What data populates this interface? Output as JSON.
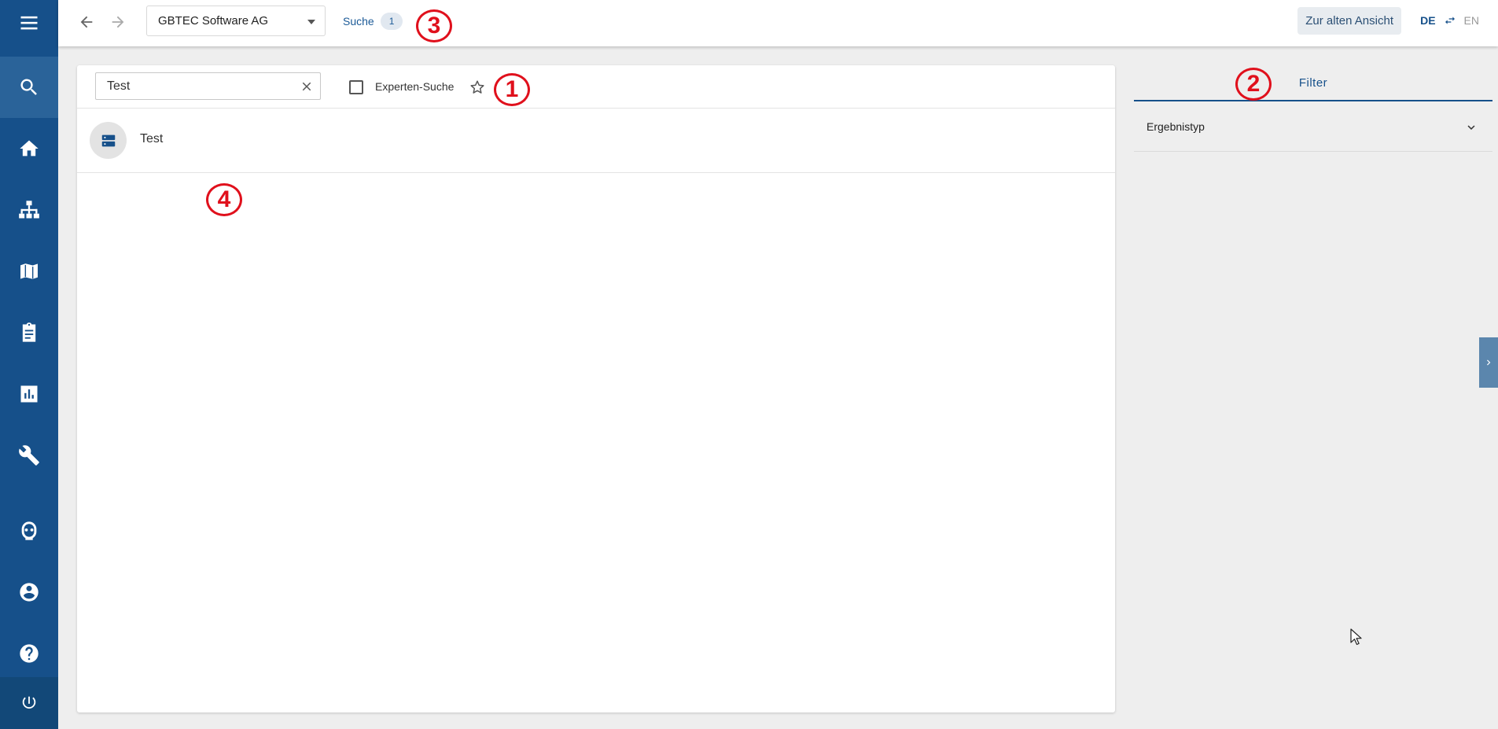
{
  "sidebar": {
    "items": [
      {
        "id": "search",
        "icon": "search-icon",
        "active": true
      },
      {
        "id": "home",
        "icon": "home-icon"
      },
      {
        "id": "hierarchy",
        "icon": "sitemap-icon"
      },
      {
        "id": "book",
        "icon": "book-icon"
      },
      {
        "id": "tasks",
        "icon": "clipboard-icon"
      },
      {
        "id": "reports",
        "icon": "chart-icon"
      },
      {
        "id": "admin",
        "icon": "wrench-icon"
      },
      {
        "id": "bot",
        "icon": "robot-icon"
      },
      {
        "id": "profile",
        "icon": "user-icon"
      },
      {
        "id": "help",
        "icon": "help-icon"
      },
      {
        "id": "logout",
        "icon": "power-icon"
      }
    ],
    "colors": {
      "background": "#16508a",
      "active": "#2a6399"
    }
  },
  "header": {
    "organization": "GBTEC Software AG",
    "breadcrumb": {
      "label": "Suche",
      "count": "1"
    },
    "old_view_button": "Zur alten Ansicht",
    "language": {
      "active": "DE",
      "inactive": "EN"
    }
  },
  "search": {
    "query": "Test",
    "expert_label": "Experten-Suche",
    "expert_checked": false
  },
  "results": [
    {
      "label": "Test",
      "icon": "database-icon"
    }
  ],
  "filter": {
    "tab_label": "Filter",
    "sections": [
      {
        "label": "Ergebnistyp",
        "expanded": false
      }
    ]
  },
  "annotations": [
    "1",
    "2",
    "3",
    "4"
  ],
  "colors": {
    "primary": "#16508a",
    "marker": "#e0101c"
  }
}
